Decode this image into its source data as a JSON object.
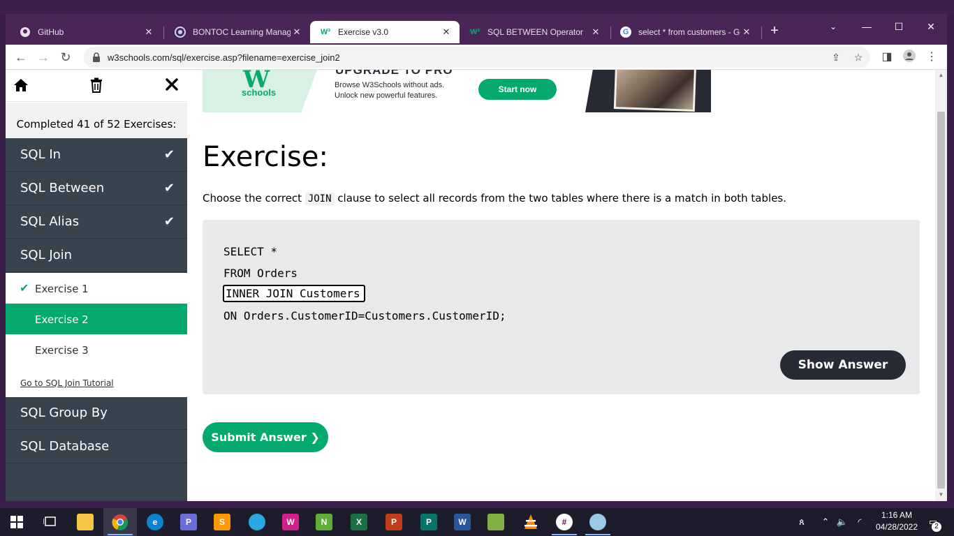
{
  "browser": {
    "tabs": [
      {
        "title": "GitHub",
        "favicon": "github-icon",
        "active": false
      },
      {
        "title": "BONTOC Learning Managem",
        "favicon": "lms-icon",
        "active": false
      },
      {
        "title": "Exercise v3.0",
        "favicon": "w3schools-icon",
        "active": true
      },
      {
        "title": "SQL BETWEEN Operator",
        "favicon": "w3schools-icon",
        "active": false
      },
      {
        "title": "select * from customers - Go",
        "favicon": "google-icon",
        "active": false
      }
    ],
    "url": "w3schools.com/sql/exercise.asp?filename=exercise_join2"
  },
  "sidebar": {
    "progress": "Completed 41 of 52 Exercises:",
    "items": [
      {
        "label": "SQL In",
        "done": true
      },
      {
        "label": "SQL Between",
        "done": true
      },
      {
        "label": "SQL Alias",
        "done": true
      },
      {
        "label": "SQL Join",
        "done": false
      }
    ],
    "sub_items": [
      {
        "label": "Exercise 1",
        "done": true
      },
      {
        "label": "Exercise 2",
        "current": true
      },
      {
        "label": "Exercise 3"
      }
    ],
    "tutorial_link": "Go to SQL Join Tutorial",
    "items_after": [
      {
        "label": "SQL Group By"
      },
      {
        "label": "SQL Database"
      }
    ]
  },
  "ad": {
    "logo_text": "schools",
    "headline": "UPGRADE TO PRO",
    "line1": "Browse W3Schools without ads.",
    "line2": "Unlock new powerful features.",
    "cta": "Start now"
  },
  "exercise": {
    "title": "Exercise:",
    "instruction_before": "Choose the correct ",
    "instruction_code": "JOIN",
    "instruction_after": " clause to select all records from the two tables where there is a match in both tables.",
    "code_line1": "SELECT *",
    "code_line2": "FROM Orders",
    "answer_value": "INNER JOIN Customers",
    "code_line4": "ON Orders.CustomerID=Customers.CustomerID;",
    "show_answer": "Show Answer",
    "submit": "Submit Answer ❯"
  },
  "taskbar": {
    "time": "1:16 AM",
    "date": "04/28/2022",
    "notifications": "2"
  },
  "colors": {
    "accent": "#04aa6d",
    "sidebar_bg": "#38444d",
    "dark_button": "#282a35",
    "code_bg": "#e7e9eb"
  }
}
